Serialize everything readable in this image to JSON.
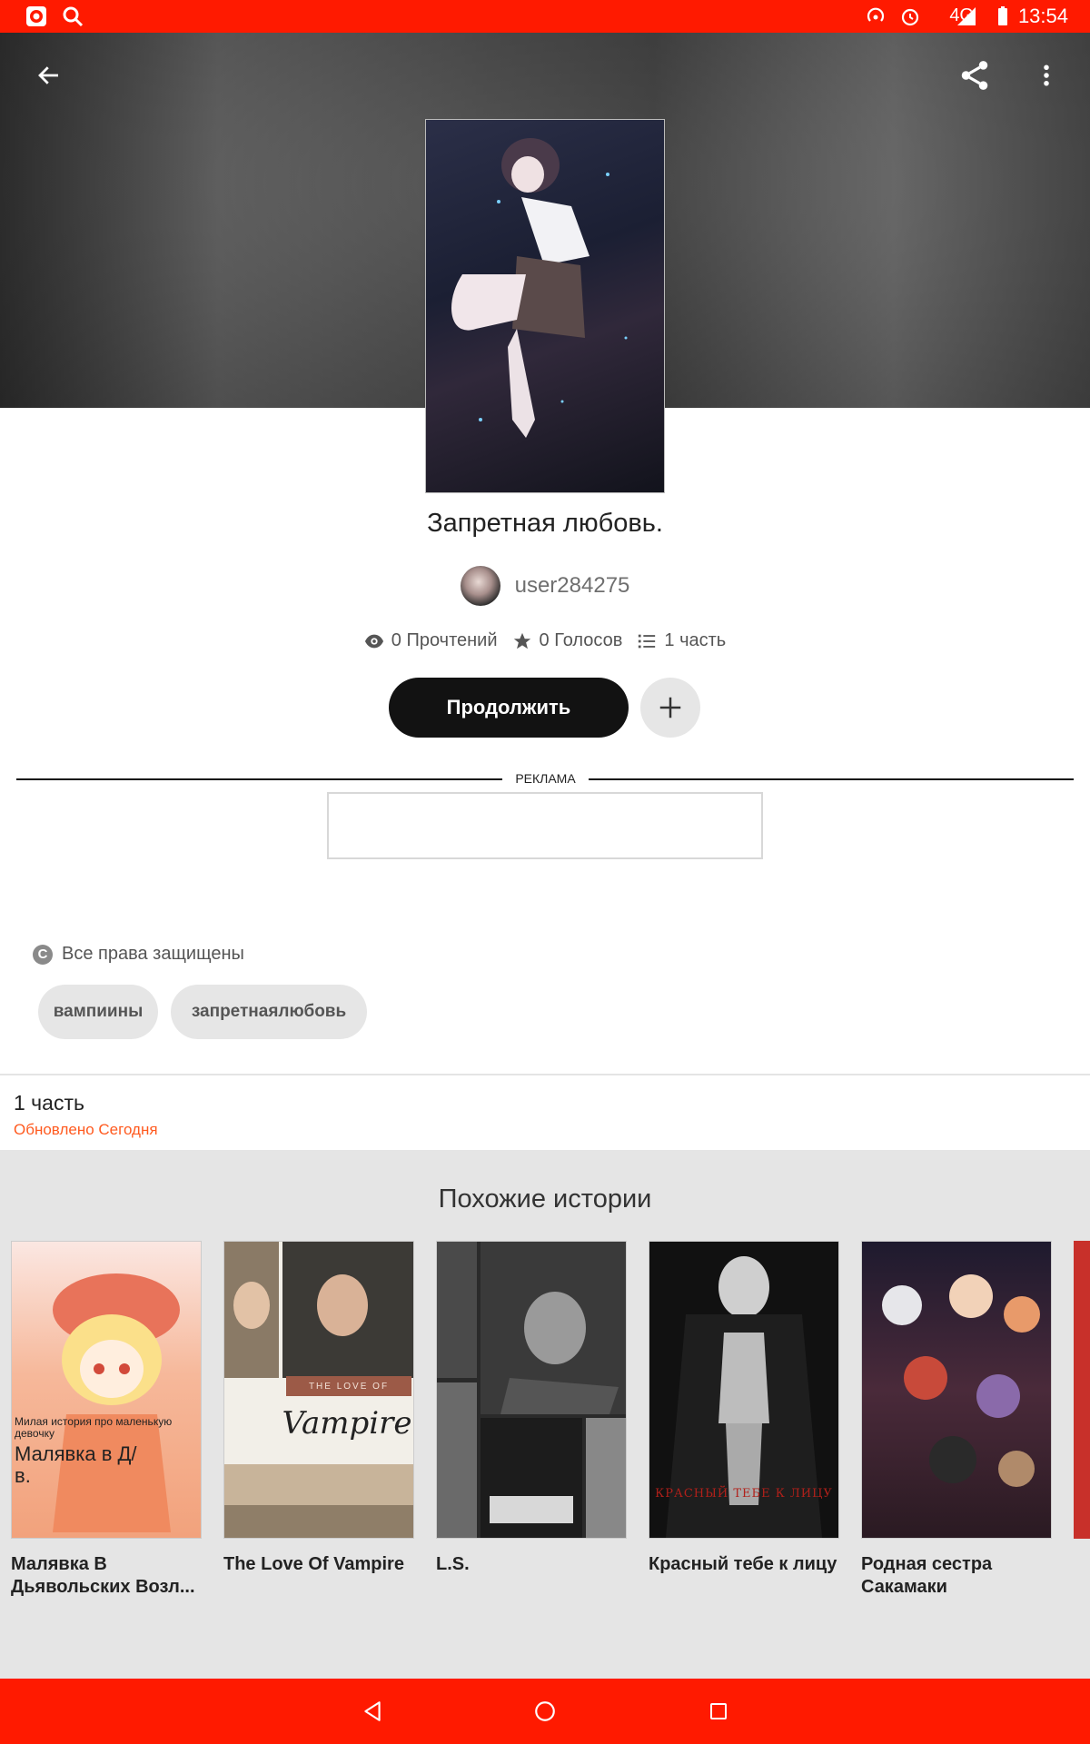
{
  "status_bar": {
    "time": "13:54",
    "network": "4G"
  },
  "story": {
    "title": "Запретная любовь.",
    "author": "user284275",
    "reads": "0 Прочтений",
    "votes": "0 Голосов",
    "parts": "1 часть",
    "continue_label": "Продолжить",
    "ad_label": "РЕКЛАМА",
    "copyright": "Все права защищены",
    "tags": [
      "вампиины",
      "запретнаялюбовь"
    ]
  },
  "parts_section": {
    "title": "1 часть",
    "updated": "Обновлено Сегодня"
  },
  "similar": {
    "title": "Похожие истории",
    "items": [
      {
        "title": "Малявка В Дьявольских Возл...",
        "cover_text": [
          "Милая история про маленькую девочку",
          "Малявка в Д/в."
        ]
      },
      {
        "title": "The Love Of Vampire",
        "cover_text": [
          "THE LOVE OF",
          "Vampire"
        ]
      },
      {
        "title": "L.S."
      },
      {
        "title": "Красный тебе к лицу",
        "cover_text": [
          "КРАСНЫЙ ТЕБЕ К ЛИЦУ"
        ]
      },
      {
        "title": "Родная сестра Сакамаки"
      }
    ]
  },
  "colors": {
    "accent": "#ff1a00",
    "updated": "#ff5a1f",
    "button": "#121212"
  }
}
